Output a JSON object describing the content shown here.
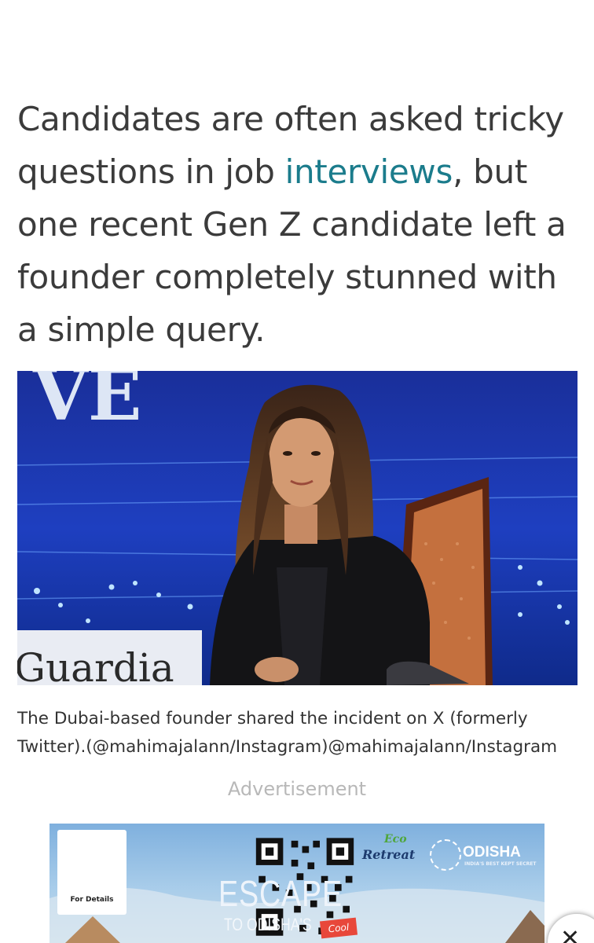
{
  "article": {
    "lead_before_link": "Candidates are often asked tricky questions in job ",
    "lead_link": "interviews",
    "lead_after_link": ", but one recent Gen Z candidate left a founder completely stunned with a simple query."
  },
  "photo": {
    "backdrop_top_text": "VE",
    "backdrop_bottom_text": "Guardia"
  },
  "caption": "The Dubai-based founder shared the incident on X (formerly Twitter).(@mahimajalann/Instagram)@mahimajalann/Instagram",
  "ad": {
    "label": "Advertisement",
    "qr_label": "For Details",
    "brand_left_eco": "Eco",
    "brand_left": "Retreat",
    "brand_right": "ODISHA",
    "brand_right_sub": "INDIA'S BEST KEPT SECRET",
    "headline": "ESCAPE",
    "subline": "TO ODISHA'S",
    "subline_badge": "Cool"
  },
  "colors": {
    "link": "#1b7c8c",
    "text": "#3b3b3b",
    "ad_label": "#b8b8b8"
  }
}
